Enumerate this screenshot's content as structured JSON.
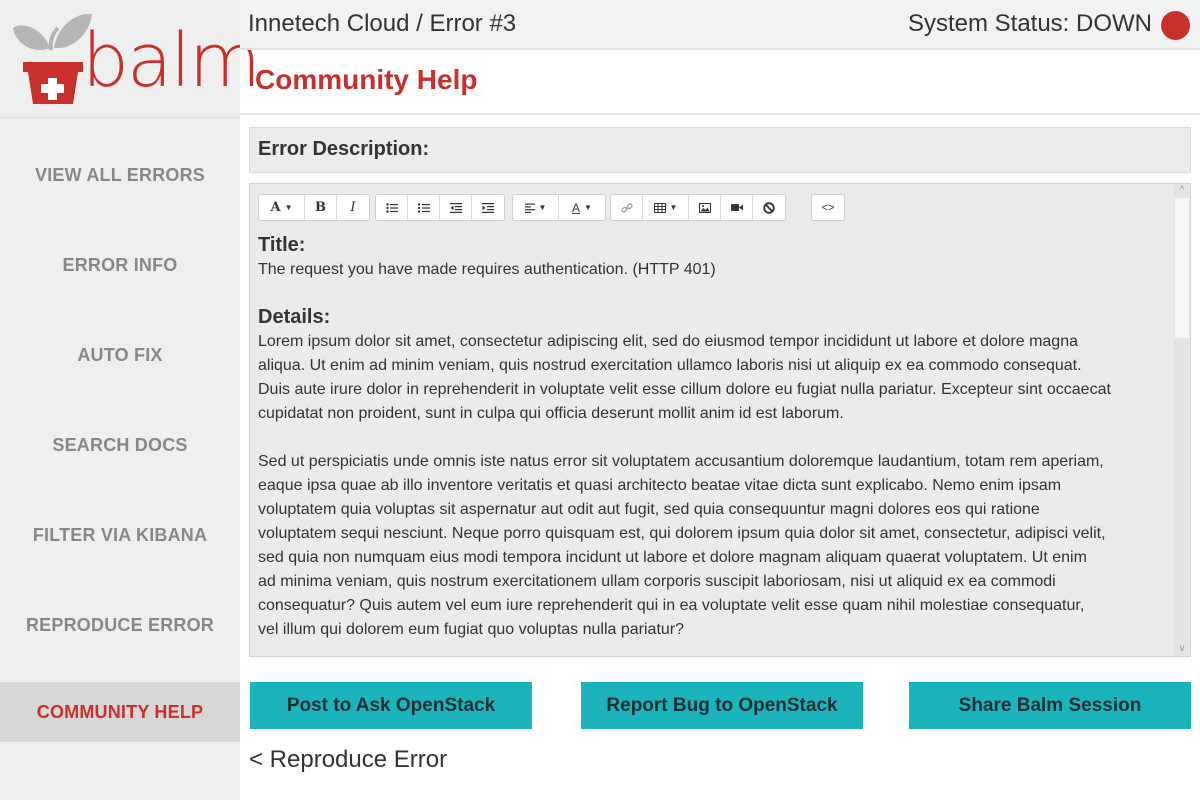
{
  "brand": {
    "logo_text": "balm",
    "accent": "#c9302c",
    "teal": "#1cb4bb"
  },
  "header": {
    "breadcrumb": "Innetech Cloud / Error #3",
    "status_text": "System Status: DOWN",
    "status_color": "#c9302c"
  },
  "sidebar": {
    "items": [
      {
        "label": "VIEW ALL ERRORS"
      },
      {
        "label": "ERROR INFO"
      },
      {
        "label": "AUTO FIX"
      },
      {
        "label": "SEARCH DOCS"
      },
      {
        "label": "FILTER VIA KIBANA"
      },
      {
        "label": "REPRODUCE ERROR"
      },
      {
        "label": "COMMUNITY HELP",
        "active": true
      }
    ]
  },
  "main": {
    "page_title": "Community Help",
    "description_label": "Error Description:",
    "editor": {
      "toolbar_icons": [
        "font-icon",
        "bold-icon",
        "italic-icon",
        "bullet-list-icon",
        "numbered-list-icon",
        "outdent-icon",
        "indent-icon",
        "align-icon",
        "text-color-icon",
        "link-icon",
        "table-icon",
        "image-icon",
        "video-icon",
        "clear-format-icon",
        "code-view-icon"
      ],
      "toolbar_glyphs": {
        "font": "A",
        "bold": "B",
        "italic": "I",
        "text_color": "A",
        "code": "<>"
      },
      "title_heading": "Title:",
      "title_text": "The request you have made requires authentication. (HTTP 401)",
      "details_heading": "Details:",
      "details_paragraphs": [
        [
          "Lorem ipsum dolor sit amet, consectetur adipiscing elit, sed do eiusmod tempor incididunt ut labore et dolore magna",
          "aliqua. Ut enim ad minim veniam, quis nostrud exercitation ullamco laboris nisi ut aliquip ex ea commodo consequat.",
          "Duis aute irure dolor in reprehenderit in voluptate velit esse cillum dolore eu fugiat nulla pariatur. Excepteur sint occaecat",
          "cupidatat non proident, sunt in culpa qui officia deserunt mollit anim id est laborum."
        ],
        [
          "Sed ut perspiciatis unde omnis iste natus error sit voluptatem accusantium doloremque laudantium, totam rem aperiam,",
          "eaque ipsa quae ab illo inventore veritatis et quasi architecto beatae vitae dicta sunt explicabo. Nemo enim ipsam",
          "voluptatem quia voluptas sit aspernatur aut odit aut fugit, sed quia consequuntur magni dolores eos qui ratione",
          "voluptatem sequi nesciunt. Neque porro quisquam est, qui dolorem ipsum quia dolor sit amet, consectetur, adipisci velit,",
          "sed quia non numquam eius modi tempora incidunt ut labore et dolore magnam aliquam quaerat voluptatem. Ut enim",
          "ad minima veniam, quis nostrum exercitationem ullam corporis suscipit laboriosam, nisi ut aliquid ex ea commodi",
          "consequatur? Quis autem vel eum iure reprehenderit qui in ea voluptate velit esse quam nihil molestiae consequatur,",
          "vel illum qui dolorem eum fugiat quo voluptas nulla pariatur?"
        ]
      ]
    },
    "actions": {
      "ask": "Post to Ask OpenStack",
      "bug": "Report Bug to OpenStack",
      "share": "Share Balm Session"
    },
    "back_link": "< Reproduce Error"
  }
}
